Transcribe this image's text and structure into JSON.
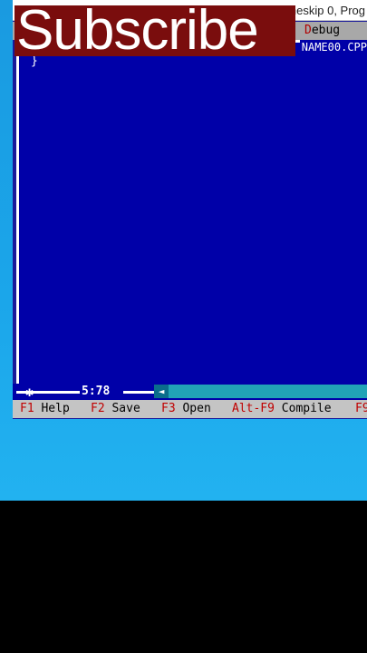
{
  "overlay": {
    "subscribe_text": "Subscribe"
  },
  "window": {
    "title_text": "meskip 0, Prog",
    "menu_visible": [
      {
        "prefix": "",
        "hot": "",
        "rest": "e"
      },
      {
        "prefix": "",
        "hot": "D",
        "rest": "ebug"
      }
    ],
    "file_name": "NAME00.CPP"
  },
  "editor": {
    "code_lines": [
      "}"
    ],
    "cursor_position": "5:78",
    "status_star": "✱"
  },
  "helpbar": [
    {
      "key": "F1",
      "label": " Help"
    },
    {
      "key": "F2",
      "label": " Save"
    },
    {
      "key": "F3",
      "label": " Open"
    },
    {
      "key": "Alt-F9",
      "label": " Compile"
    },
    {
      "key": "F9",
      "label": ""
    }
  ],
  "colors": {
    "editor_bg": "#0000a8",
    "menu_bg": "#a8a8a8",
    "help_key": "#c00000",
    "desktop": "#1ba6ea",
    "subscribe_bg": "#7a0d0d"
  }
}
